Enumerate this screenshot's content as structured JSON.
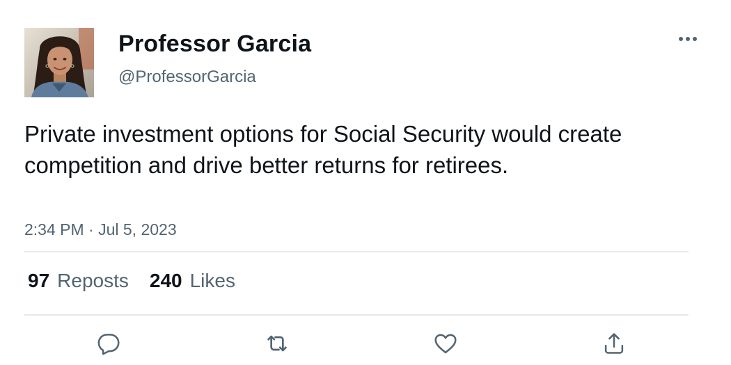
{
  "author": {
    "display_name": "Professor Garcia",
    "handle": "@ProfessorGarcia",
    "avatar_icon": "profile-photo"
  },
  "tweet": {
    "text": "Private investment options for Social Security would create competition and drive better returns for retirees.",
    "timestamp": "2:34 PM · Jul 5, 2023"
  },
  "stats": {
    "reposts_count": "97",
    "reposts_label": "Reposts",
    "likes_count": "240",
    "likes_label": "Likes"
  },
  "actions": [
    {
      "name": "reply",
      "icon": "speech-bubble-icon"
    },
    {
      "name": "repost",
      "icon": "repost-arrows-icon"
    },
    {
      "name": "like",
      "icon": "heart-icon"
    },
    {
      "name": "share",
      "icon": "share-upload-icon"
    }
  ],
  "colors": {
    "primary_text": "#0f1419",
    "secondary_text": "#536471",
    "divider": "#e6e9eb",
    "background": "#ffffff"
  }
}
